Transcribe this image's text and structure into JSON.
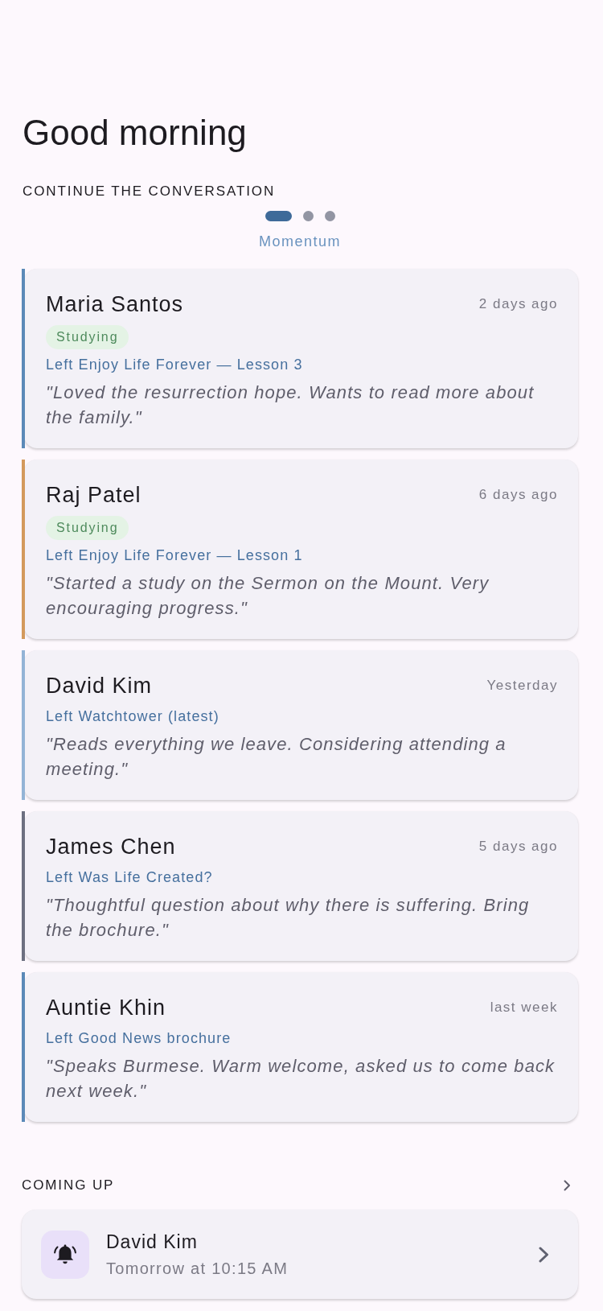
{
  "greeting": "Good morning",
  "continue_section": {
    "title": "CONTINUE THE CONVERSATION",
    "pager": {
      "dots": [
        {
          "selected": true
        },
        {
          "selected": false
        },
        {
          "selected": false
        }
      ],
      "label": "Momentum"
    },
    "conversations": [
      {
        "name": "Maria Santos",
        "time": "2 days ago",
        "status": "Studying",
        "left": "Left Enjoy Life Forever — Lesson 3",
        "note": "\"Loved the resurrection hope. Wants to read more about the family.\"",
        "color": "#5b8ab8"
      },
      {
        "name": "Raj Patel",
        "time": "6 days ago",
        "status": "Studying",
        "left": "Left Enjoy Life Forever — Lesson 1",
        "note": "\"Started a study on the Sermon on the Mount. Very encouraging progress.\"",
        "color": "#d39a5c"
      },
      {
        "name": "David Kim",
        "time": "Yesterday",
        "left": "Left Watchtower (latest)",
        "note": "\"Reads everything we leave. Considering attending a meeting.\"",
        "color": "#93b4d6"
      },
      {
        "name": "James Chen",
        "time": "5 days ago",
        "left": "Left Was Life Created?",
        "note": "\"Thoughtful question about why there is suffering. Bring the brochure.\"",
        "color": "#6c7080"
      },
      {
        "name": "Auntie Khin",
        "time": "last week",
        "left": "Left Good News brochure",
        "note": "\"Speaks Burmese. Warm welcome, asked us to come back next week.\"",
        "color": "#5b8ab8"
      }
    ]
  },
  "coming_up": {
    "title": "COMING UP",
    "items": [
      {
        "name": "David Kim",
        "time": "Tomorrow at 10:15 AM"
      }
    ]
  }
}
